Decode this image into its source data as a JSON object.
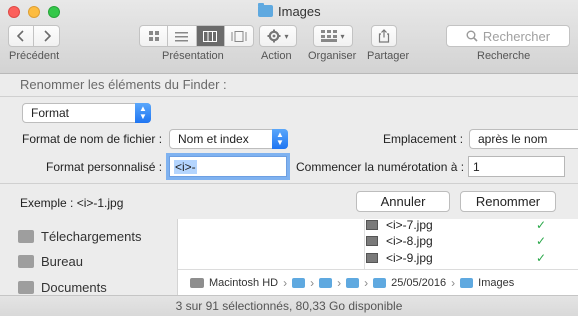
{
  "window": {
    "title": "Images",
    "title_icon": "folder-icon"
  },
  "toolbar": {
    "back_label": "Précédent",
    "view_label": "Présentation",
    "action_label": "Action",
    "arrange_label": "Organiser",
    "share_label": "Partager",
    "search_label": "Recherche",
    "search_placeholder": "Rechercher"
  },
  "rename": {
    "title": "Renommer les éléments du Finder :",
    "mode_value": "Format",
    "name_format_label": "Format de nom de fichier :",
    "name_format_value": "Nom et index",
    "where_label": "Emplacement :",
    "where_value": "après le nom",
    "custom_format_label": "Format personnalisé :",
    "custom_format_value": "<i>-",
    "start_numbers_label": "Commencer la numérotation à :",
    "start_numbers_value": "1",
    "example_text": "Exemple : <i>-1.jpg",
    "cancel_label": "Annuler",
    "rename_label": "Renommer"
  },
  "sidebar": {
    "items": [
      {
        "label": "Télechargements",
        "icon": "downloads-folder-icon"
      },
      {
        "label": "Bureau",
        "icon": "desktop-folder-icon"
      },
      {
        "label": "Documents",
        "icon": "documents-folder-icon"
      }
    ]
  },
  "files": [
    {
      "name": "<i>-7.jpg",
      "status": "✓"
    },
    {
      "name": "<i>-8.jpg",
      "status": "✓"
    },
    {
      "name": "<i>-9.jpg",
      "status": "✓"
    }
  ],
  "pathbar": {
    "items": [
      "Macintosh HD",
      "",
      "",
      "",
      "25/05/2016",
      "Images"
    ]
  },
  "status": {
    "text": "3 sur 91 sélectionnés, 80,33 Go disponible"
  },
  "colors": {
    "accent": "#1f75f2",
    "folder": "#5fa9e0",
    "check": "#2aa84a"
  }
}
